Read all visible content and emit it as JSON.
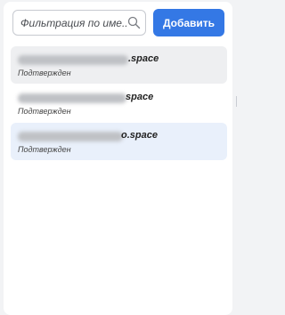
{
  "search": {
    "placeholder": "Фильтрация по име..."
  },
  "toolbar": {
    "add_label": "Добавить"
  },
  "accounts": [
    {
      "domain_suffix": ".space",
      "status": "Подтвержден"
    },
    {
      "domain_suffix": "space",
      "status": "Подтвержден"
    },
    {
      "domain_suffix": "o.space",
      "status": "Подтвержден"
    }
  ],
  "colors": {
    "accent": "#3478e5",
    "selected_bg": "#e9f0fb",
    "hover_bg": "#eeeff1"
  }
}
